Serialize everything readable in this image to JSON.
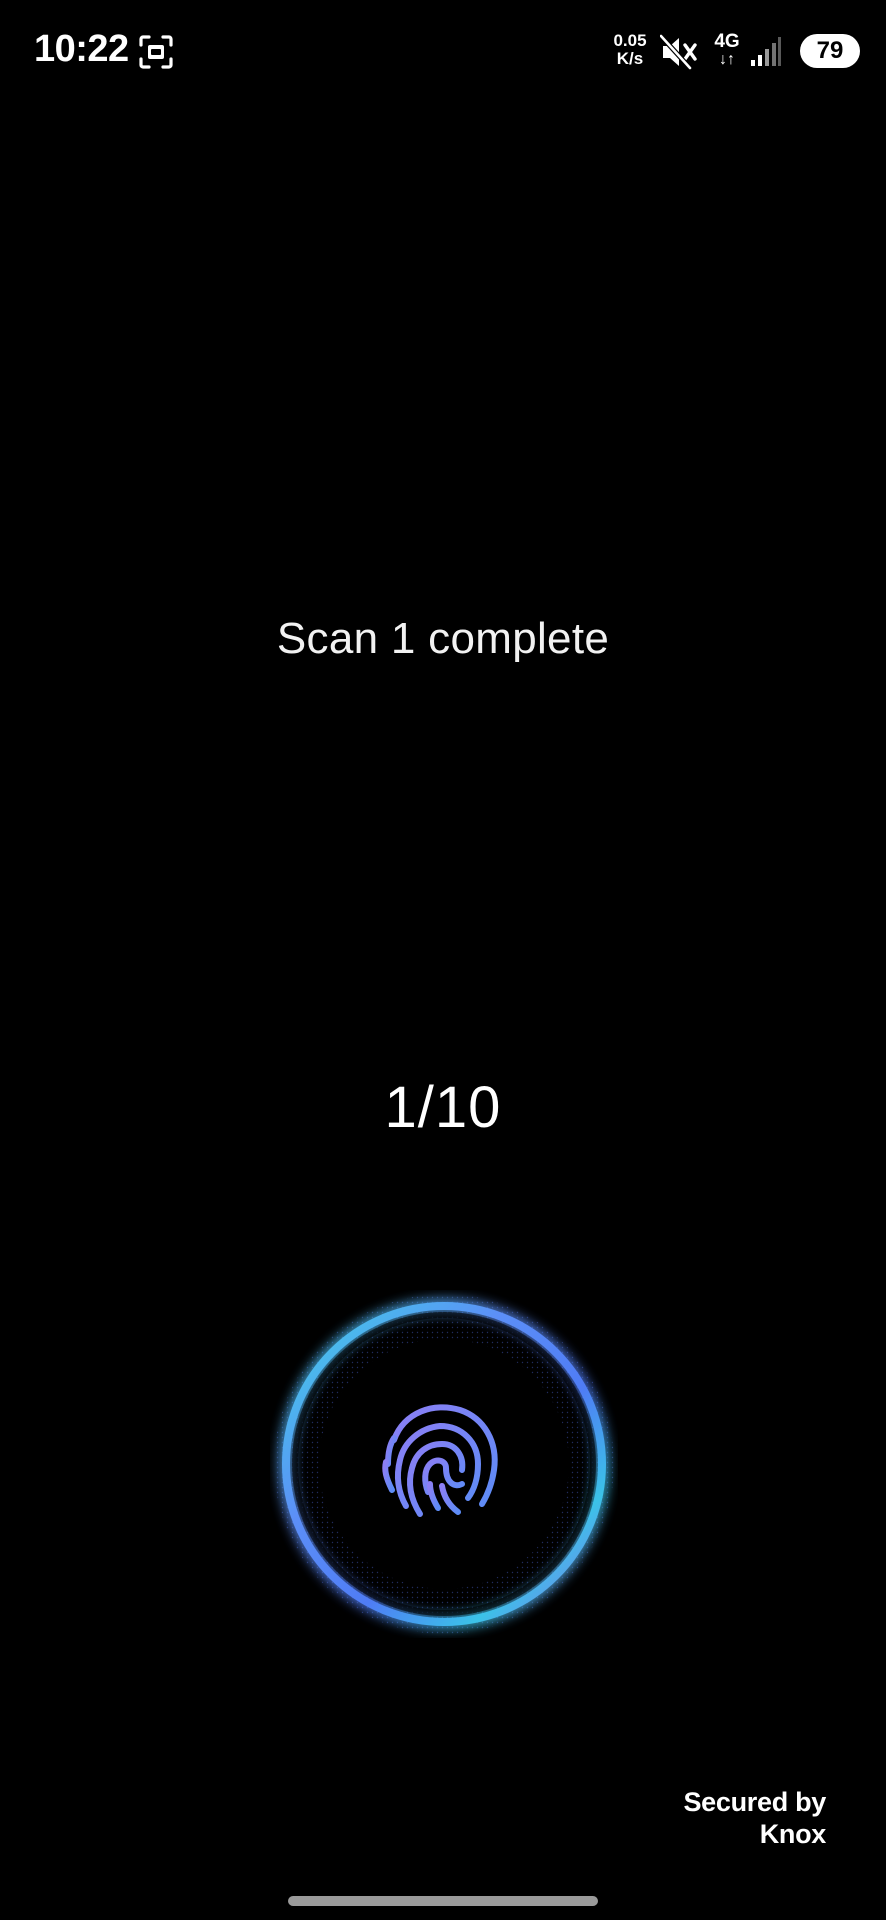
{
  "status_bar": {
    "time": "10:22",
    "net_speed_value": "0.05",
    "net_speed_unit": "K/s",
    "network_type": "4G",
    "network_arrows": "↓↑",
    "battery_level": "79",
    "icons": [
      "screenshot-icon",
      "mute-icon",
      "signal-icon"
    ]
  },
  "enrollment": {
    "message": "Scan 1 complete",
    "progress_text": "1/10",
    "progress_fraction": 0.1
  },
  "footer": {
    "secured_by": "Secured by",
    "brand": "Knox"
  },
  "colors": {
    "background": "#000000",
    "text": "#ffffff",
    "ring_cyan": "#3fd3e6",
    "ring_blue": "#4f7cf5",
    "ring_purple": "#8a6ef0",
    "fingerprint": "#7f8cf7"
  }
}
